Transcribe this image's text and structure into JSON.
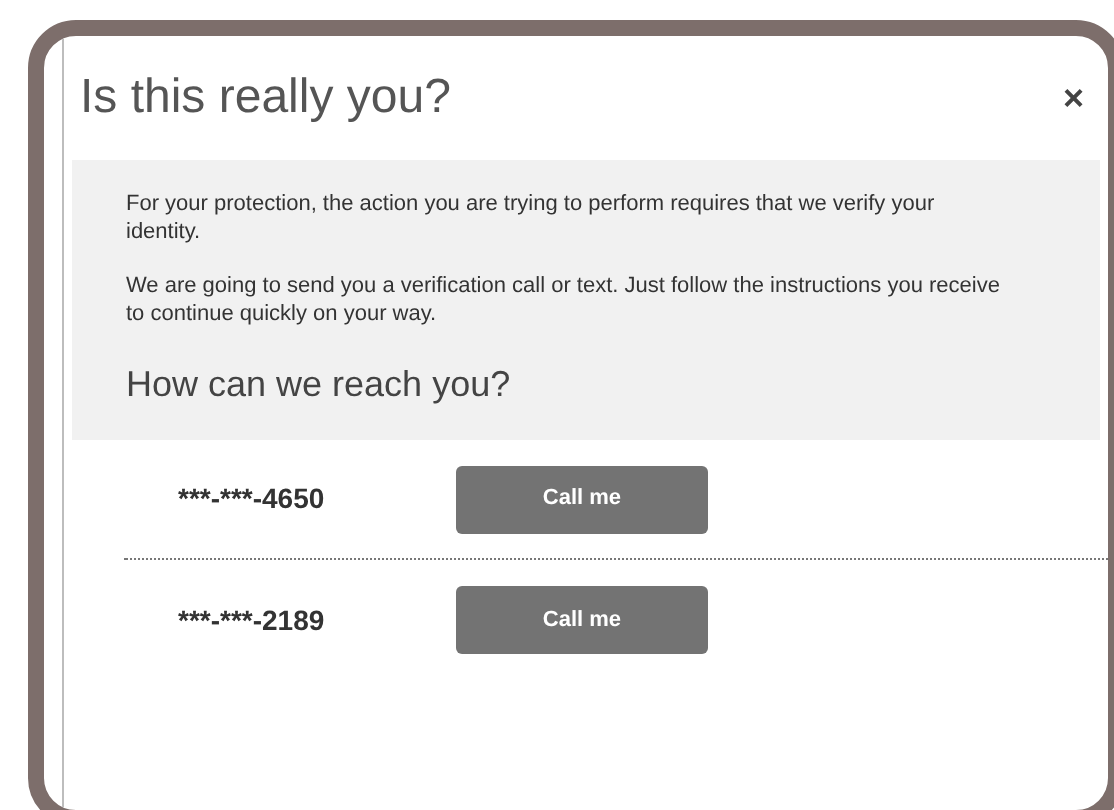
{
  "dialog": {
    "title": "Is this really you?",
    "close": "×",
    "paragraphs": [
      "For your protection, the action you are trying to perform requires that we verify your identity.",
      "We are going to send you a verification call or text. Just follow the instructions you receive to continue quickly on your way."
    ],
    "heading": "How can we reach you?",
    "contacts": [
      {
        "number": "***-***-4650",
        "button": "Call me"
      },
      {
        "number": "***-***-2189",
        "button": "Call me"
      }
    ]
  }
}
